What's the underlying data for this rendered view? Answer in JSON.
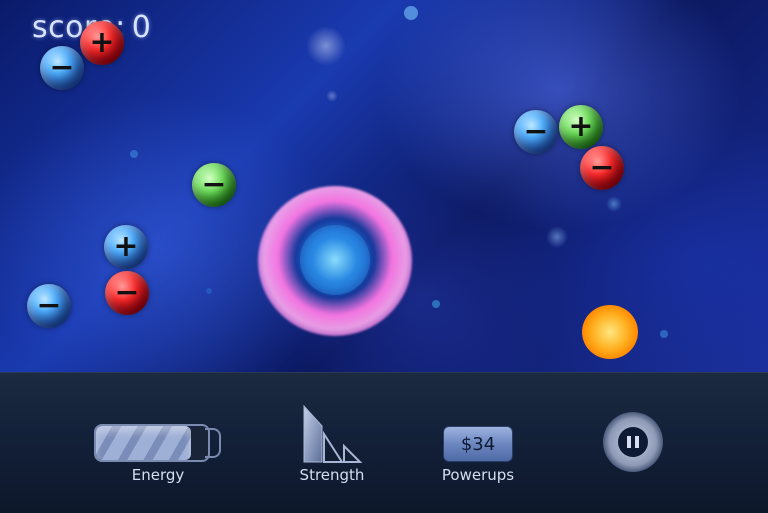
{
  "score": {
    "label": "score:",
    "value": "0"
  },
  "hud": {
    "energy_label": "Energy",
    "energy_level": 0.85,
    "strength_label": "Strength",
    "powerups_label": "Powerups",
    "powerups_price": "$34"
  },
  "particles": [
    {
      "sign": "+",
      "color": "red"
    },
    {
      "sign": "−",
      "color": "blue"
    },
    {
      "sign": "−",
      "color": "green"
    },
    {
      "sign": "+",
      "color": "blue"
    },
    {
      "sign": "−",
      "color": "red"
    },
    {
      "sign": "−",
      "color": "blue"
    },
    {
      "sign": "−",
      "color": "blue"
    },
    {
      "sign": "+",
      "color": "green"
    },
    {
      "sign": "−",
      "color": "red"
    }
  ],
  "colors": {
    "hud_bg": "#13213a",
    "label_text": "#d6def0",
    "space_blue": "#1a3ab0"
  }
}
